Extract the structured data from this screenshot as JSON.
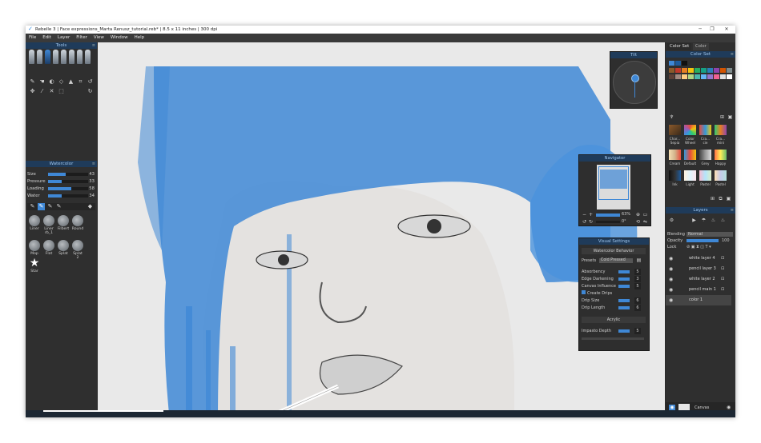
{
  "window": {
    "title": "Rebelle 3 | Face expressions_Marta Renusz_tutorial.reb* | 8.5 x 11 inches | 300 dpi",
    "controls": {
      "minimize": "─",
      "maximize": "❐",
      "close": "✕"
    }
  },
  "menu": [
    "File",
    "Edit",
    "Layer",
    "Filter",
    "View",
    "Window",
    "Help"
  ],
  "tools_panel": {
    "title": "Tools"
  },
  "watercolor_panel": {
    "title": "Watercolor",
    "props": [
      {
        "label": "Size",
        "value": "43",
        "level": 0.43
      },
      {
        "label": "Pressure",
        "value": "33",
        "level": 0.33
      },
      {
        "label": "Loading",
        "value": "58",
        "level": 0.58
      },
      {
        "label": "Water",
        "value": "34",
        "level": 0.34
      }
    ],
    "presets": [
      "Liner",
      "Liner rb_1",
      "Filbert",
      "Round",
      "Mop",
      "Flat",
      "Splat",
      "Splat 2",
      "Star"
    ]
  },
  "tilt_panel": {
    "title": "Tilt"
  },
  "navigator": {
    "title": "Navigator",
    "zoom": "63%",
    "rotation": "0°"
  },
  "visual_settings": {
    "title": "Visual Settings",
    "section1": "Watercolor Behavior",
    "presets_label": "Presets",
    "presets_value": "Cold Pressed",
    "rows": [
      {
        "label": "Absorbency",
        "value": "5"
      },
      {
        "label": "Edge Darkening",
        "value": "3"
      },
      {
        "label": "Canvas Influence",
        "value": "5"
      }
    ],
    "create_drips": "Create Drips",
    "drip_rows": [
      {
        "label": "Drip Size",
        "value": "6"
      },
      {
        "label": "Drip Length",
        "value": "6"
      }
    ],
    "section2": "Acrylic",
    "impasto": {
      "label": "Impasto Depth",
      "value": "5"
    }
  },
  "color_tabs": [
    "Color Set",
    "Color"
  ],
  "color_set": {
    "title": "Color Set",
    "thumbs": [
      "Char... Sepia",
      "Color Wheel",
      "Cra... cie",
      "Cra... mini",
      "Cream",
      "Default",
      "Grey",
      "Happy",
      "Ink",
      "Light",
      "Pastel",
      "Pastel"
    ]
  },
  "layers": {
    "title": "Layers",
    "blending_label": "Blending",
    "blending_value": "Normal",
    "opacity_label": "Opacity",
    "opacity_value": "100",
    "lock_label": "Lock",
    "items": [
      {
        "name": "white layer 4"
      },
      {
        "name": "pencil layer 3"
      },
      {
        "name": "white layer 2"
      },
      {
        "name": "pencil main 1"
      },
      {
        "name": "color 1"
      }
    ],
    "canvas_label": "Canvas"
  },
  "colors": {
    "accent": "#3f88d6",
    "panel_header": "#1f3b5a",
    "paint_blue": "#3f88d6"
  }
}
